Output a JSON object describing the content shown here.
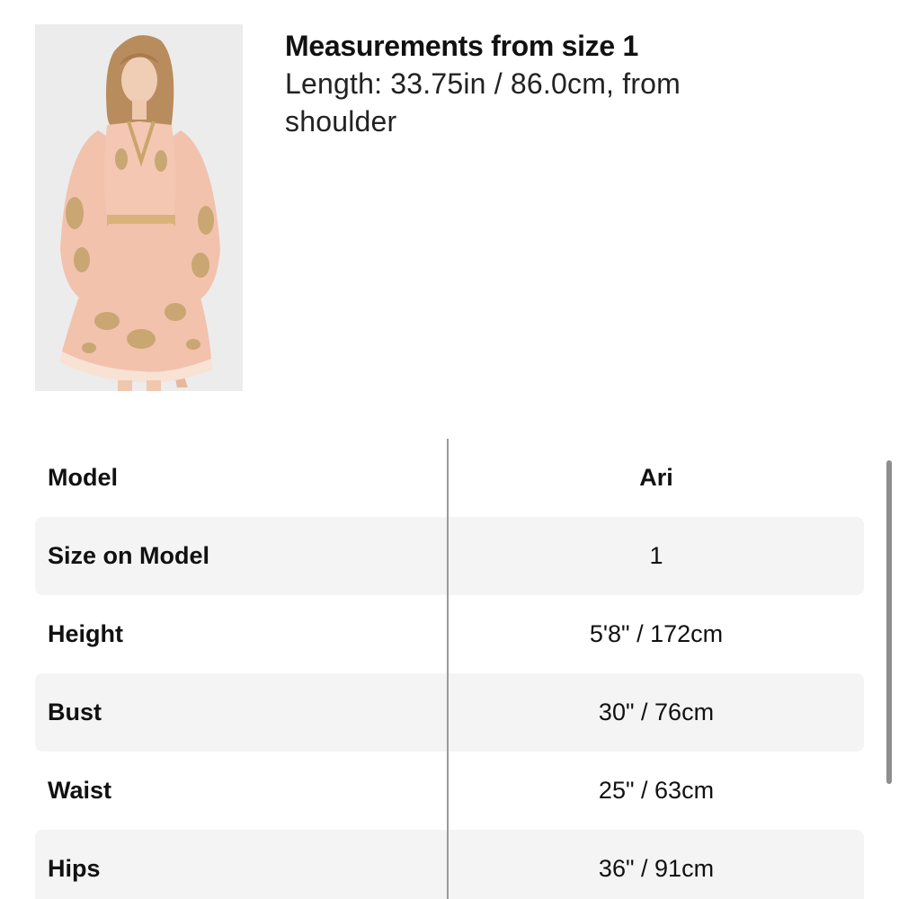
{
  "header": {
    "measurements_title": "Measurements from size 1",
    "measurements_detail": "Length: 33.75in / 86.0cm, from shoulder"
  },
  "product": {
    "image_description": "model wearing peach floral wrap dress",
    "colors": {
      "dress": "#f2c2ad",
      "print": "#c2a268",
      "background": "#ececec"
    }
  },
  "model_table": {
    "rows": [
      {
        "label": "Model",
        "value": "Ari",
        "shaded": false
      },
      {
        "label": "Size on Model",
        "value": "1",
        "shaded": true
      },
      {
        "label": "Height",
        "value": "5'8\" / 172cm",
        "shaded": false
      },
      {
        "label": "Bust",
        "value": "30\" / 76cm",
        "shaded": true
      },
      {
        "label": "Waist",
        "value": "25\" / 63cm",
        "shaded": false
      },
      {
        "label": "Hips",
        "value": "36\" / 91cm",
        "shaded": true
      }
    ]
  }
}
